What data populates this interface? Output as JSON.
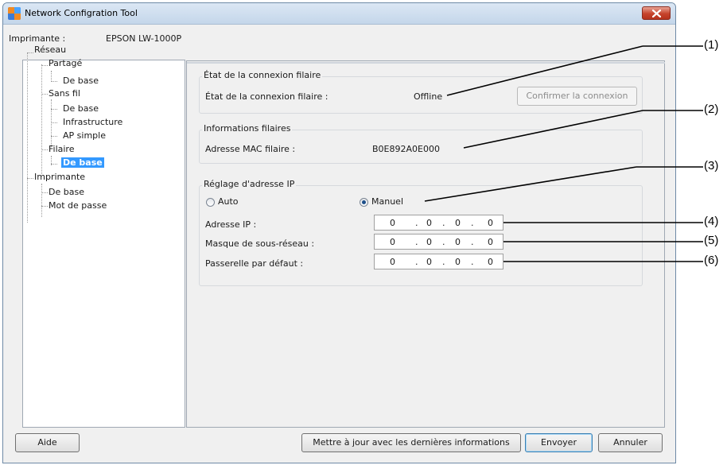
{
  "window": {
    "title": "Network Configration Tool"
  },
  "printer": {
    "label": "Imprimante :",
    "name": "EPSON LW-1000P"
  },
  "tree": {
    "reseau": "Réseau",
    "partage": "Partagé",
    "partage_base": "De base",
    "sans_fil": "Sans fil",
    "sans_fil_base": "De base",
    "infrastructure": "Infrastructure",
    "ap_simple": "AP simple",
    "filaire": "Filaire",
    "filaire_base": "De base",
    "imprimante": "Imprimante",
    "imprimante_base": "De base",
    "mot_de_passe": "Mot de passe"
  },
  "connection": {
    "group_title": "État de la connexion filaire",
    "label": "État de la connexion filaire :",
    "value": "Offline",
    "confirm_button": "Confirmer la connexion"
  },
  "wired_info": {
    "group_title": "Informations filaires",
    "mac_label": "Adresse MAC filaire :",
    "mac_value": "B0E892A0E000"
  },
  "ip_settings": {
    "group_title": "Réglage d'adresse IP",
    "auto_label": "Auto",
    "manual_label": "Manuel",
    "selected_mode": "Manuel",
    "ip_label": "Adresse IP :",
    "mask_label": "Masque de sous-réseau :",
    "gateway_label": "Passerelle par défaut :",
    "ip_value": [
      "0",
      "0",
      "0",
      "0"
    ],
    "mask_value": [
      "0",
      "0",
      "0",
      "0"
    ],
    "gateway_value": [
      "0",
      "0",
      "0",
      "0"
    ]
  },
  "buttons": {
    "help": "Aide",
    "update": "Mettre à jour avec les dernières informations",
    "send": "Envoyer",
    "cancel": "Annuler"
  },
  "callouts": [
    "(1)",
    "(2)",
    "(3)",
    "(4)",
    "(5)",
    "(6)"
  ],
  "colors": {
    "selection": "#3399ff",
    "close_button": "#c6432c"
  }
}
